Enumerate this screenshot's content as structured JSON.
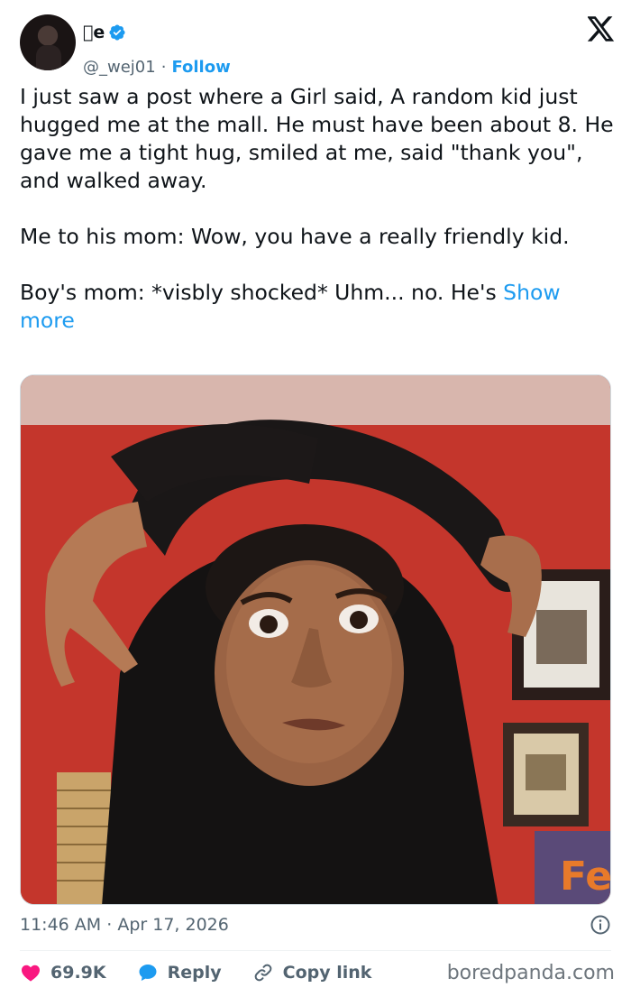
{
  "author": {
    "display_name": "e",
    "handle": "@_wej01",
    "separator": "·",
    "follow_label": "Follow"
  },
  "tweet": {
    "paragraphs": [
      "I just saw a post where a Girl said, A random kid just hugged me at the mall. He must have been about 8. He gave me a tight hug, smiled at me, said \"thank you\", and walked away.",
      "Me to his mom: Wow, you have a really friendly kid."
    ],
    "last_paragraph": "Boy's mom: *visbly shocked* Uhm... no. He's ",
    "show_more": "Show more"
  },
  "meta": {
    "time": "11:46 AM",
    "separator": "·",
    "date": "Apr 17, 2026"
  },
  "actions": {
    "likes": "69.9K",
    "reply_label": "Reply",
    "copy_link_label": "Copy link"
  },
  "watermark": "boredpanda.com",
  "colors": {
    "accent": "#1d9bf0",
    "like": "#f91880",
    "muted": "#536471"
  }
}
